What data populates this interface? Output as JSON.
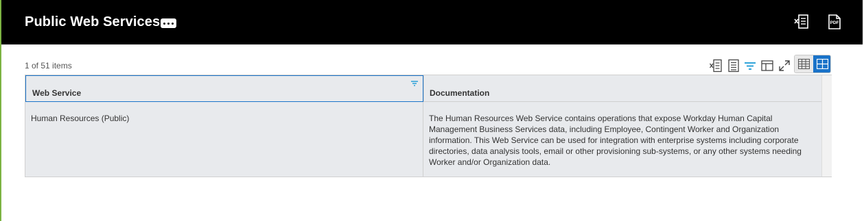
{
  "header": {
    "title": "Public Web Services",
    "more_icon": "ellipsis-icon",
    "actions": [
      {
        "name": "export-excel-icon"
      },
      {
        "name": "export-pdf-icon",
        "label": "PDF"
      }
    ]
  },
  "grid": {
    "count_text": "1 of 51 items",
    "toolbar": [
      "export-excel-icon",
      "print-icon",
      "filter-icon",
      "column-layout-icon",
      "fullscreen-icon"
    ],
    "view_toggle": {
      "selected": "grid",
      "options": [
        "table",
        "grid"
      ]
    },
    "columns": [
      "Web Service",
      "Documentation"
    ],
    "rows": [
      {
        "web_service": "Human Resources (Public)",
        "documentation_lines": [
          "The Human Resources Web Service contains operations that expose Workday Human Capital",
          "Management Business Services data, including Employee, Contingent Worker and Organization",
          "information. This Web Service can be used for integration with enterprise systems including corporate",
          "directories, data analysis tools, email or other provisioning sub-systems, or any other systems needing",
          "Worker and/or Organization data."
        ]
      }
    ]
  },
  "colors": {
    "header_bg": "#000000",
    "accent": "#1a73c9",
    "frame": "#7cb342",
    "cell_bg": "#e8eaed"
  }
}
